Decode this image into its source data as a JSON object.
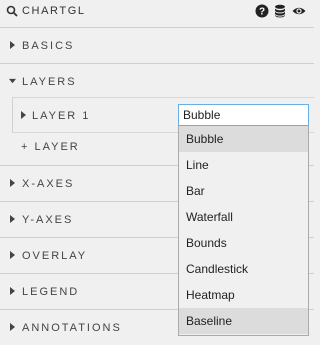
{
  "header": {
    "title": "CHARTGL",
    "icons": [
      "search-icon",
      "help-icon",
      "database-icon",
      "eye-icon"
    ]
  },
  "sections": [
    {
      "label": "BASICS",
      "state": "collapsed"
    },
    {
      "label": "LAYERS",
      "state": "expanded"
    },
    {
      "label": "X-AXES",
      "state": "collapsed"
    },
    {
      "label": "Y-AXES",
      "state": "collapsed"
    },
    {
      "label": "OVERLAY",
      "state": "collapsed"
    },
    {
      "label": "LEGEND",
      "state": "collapsed"
    },
    {
      "label": "ANNOTATIONS",
      "state": "collapsed"
    }
  ],
  "layers": {
    "items": [
      {
        "label": "LAYER 1",
        "type": "Bubble"
      }
    ],
    "add_label": "+ LAYER"
  },
  "type_dropdown": {
    "value": "Bubble",
    "options": [
      "Bubble",
      "Line",
      "Bar",
      "Waterfall",
      "Bounds",
      "Candlestick",
      "Heatmap",
      "Baseline"
    ],
    "highlighted": [
      "Bubble",
      "Baseline"
    ]
  },
  "colors": {
    "background": "#f0f0f0",
    "divider": "#cfcfcf",
    "focus_border": "#66afe9",
    "highlight": "#dcdcdc"
  }
}
